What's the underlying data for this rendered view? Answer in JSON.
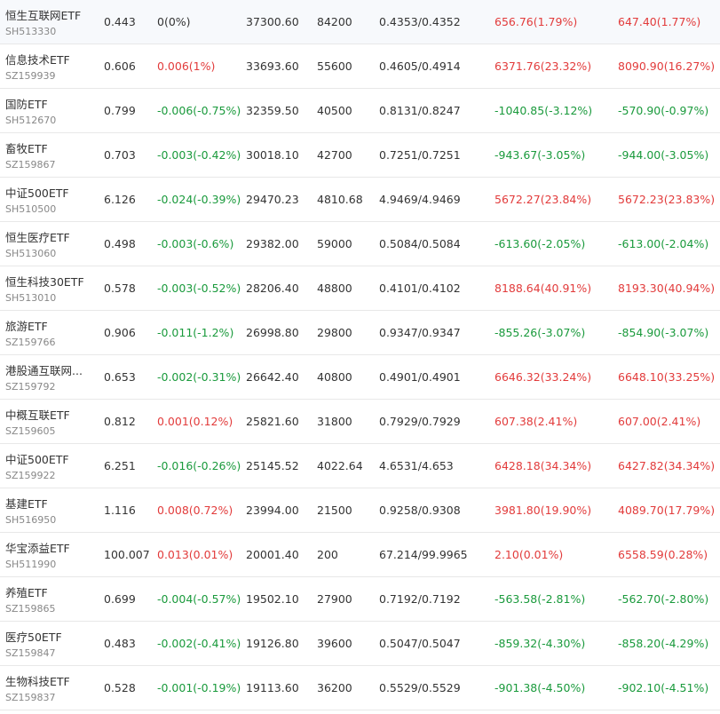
{
  "colors": {
    "up": "#e23b3b",
    "down": "#1a9a3c",
    "flat": "#333333"
  },
  "rows": [
    {
      "name": "恒生互联网ETF",
      "code": "SH513330",
      "price": "0.443",
      "change": "0(0%)",
      "change_dir": "flat",
      "amount": "37300.60",
      "volume": "84200",
      "range": "0.4353/0.4352",
      "val1": "656.76(1.79%)",
      "val1_dir": "up",
      "val2": "647.40(1.77%)",
      "val2_dir": "up"
    },
    {
      "name": "信息技术ETF",
      "code": "SZ159939",
      "price": "0.606",
      "change": "0.006(1%)",
      "change_dir": "up",
      "amount": "33693.60",
      "volume": "55600",
      "range": "0.4605/0.4914",
      "val1": "6371.76(23.32%)",
      "val1_dir": "up",
      "val2": "8090.90(16.27%)",
      "val2_dir": "up"
    },
    {
      "name": "国防ETF",
      "code": "SH512670",
      "price": "0.799",
      "change": "-0.006(-0.75%)",
      "change_dir": "down",
      "amount": "32359.50",
      "volume": "40500",
      "range": "0.8131/0.8247",
      "val1": "-1040.85(-3.12%)",
      "val1_dir": "down",
      "val2": "-570.90(-0.97%)",
      "val2_dir": "down"
    },
    {
      "name": "畜牧ETF",
      "code": "SZ159867",
      "price": "0.703",
      "change": "-0.003(-0.42%)",
      "change_dir": "down",
      "amount": "30018.10",
      "volume": "42700",
      "range": "0.7251/0.7251",
      "val1": "-943.67(-3.05%)",
      "val1_dir": "down",
      "val2": "-944.00(-3.05%)",
      "val2_dir": "down"
    },
    {
      "name": "中证500ETF",
      "code": "SH510500",
      "price": "6.126",
      "change": "-0.024(-0.39%)",
      "change_dir": "down",
      "amount": "29470.23",
      "volume": "4810.68",
      "range": "4.9469/4.9469",
      "val1": "5672.27(23.84%)",
      "val1_dir": "up",
      "val2": "5672.23(23.83%)",
      "val2_dir": "up"
    },
    {
      "name": "恒生医疗ETF",
      "code": "SH513060",
      "price": "0.498",
      "change": "-0.003(-0.6%)",
      "change_dir": "down",
      "amount": "29382.00",
      "volume": "59000",
      "range": "0.5084/0.5084",
      "val1": "-613.60(-2.05%)",
      "val1_dir": "down",
      "val2": "-613.00(-2.04%)",
      "val2_dir": "down"
    },
    {
      "name": "恒生科技30ETF",
      "code": "SH513010",
      "price": "0.578",
      "change": "-0.003(-0.52%)",
      "change_dir": "down",
      "amount": "28206.40",
      "volume": "48800",
      "range": "0.4101/0.4102",
      "val1": "8188.64(40.91%)",
      "val1_dir": "up",
      "val2": "8193.30(40.94%)",
      "val2_dir": "up"
    },
    {
      "name": "旅游ETF",
      "code": "SZ159766",
      "price": "0.906",
      "change": "-0.011(-1.2%)",
      "change_dir": "down",
      "amount": "26998.80",
      "volume": "29800",
      "range": "0.9347/0.9347",
      "val1": "-855.26(-3.07%)",
      "val1_dir": "down",
      "val2": "-854.90(-3.07%)",
      "val2_dir": "down"
    },
    {
      "name": "港股通互联网...",
      "code": "SZ159792",
      "price": "0.653",
      "change": "-0.002(-0.31%)",
      "change_dir": "down",
      "amount": "26642.40",
      "volume": "40800",
      "range": "0.4901/0.4901",
      "val1": "6646.32(33.24%)",
      "val1_dir": "up",
      "val2": "6648.10(33.25%)",
      "val2_dir": "up"
    },
    {
      "name": "中概互联ETF",
      "code": "SZ159605",
      "price": "0.812",
      "change": "0.001(0.12%)",
      "change_dir": "up",
      "amount": "25821.60",
      "volume": "31800",
      "range": "0.7929/0.7929",
      "val1": "607.38(2.41%)",
      "val1_dir": "up",
      "val2": "607.00(2.41%)",
      "val2_dir": "up"
    },
    {
      "name": "中证500ETF",
      "code": "SZ159922",
      "price": "6.251",
      "change": "-0.016(-0.26%)",
      "change_dir": "down",
      "amount": "25145.52",
      "volume": "4022.64",
      "range": "4.6531/4.653",
      "val1": "6428.18(34.34%)",
      "val1_dir": "up",
      "val2": "6427.82(34.34%)",
      "val2_dir": "up"
    },
    {
      "name": "基建ETF",
      "code": "SH516950",
      "price": "1.116",
      "change": "0.008(0.72%)",
      "change_dir": "up",
      "amount": "23994.00",
      "volume": "21500",
      "range": "0.9258/0.9308",
      "val1": "3981.80(19.90%)",
      "val1_dir": "up",
      "val2": "4089.70(17.79%)",
      "val2_dir": "up"
    },
    {
      "name": "华宝添益ETF",
      "code": "SH511990",
      "price": "100.007",
      "change": "0.013(0.01%)",
      "change_dir": "up",
      "amount": "20001.40",
      "volume": "200",
      "range": "67.214/99.9965",
      "val1": "2.10(0.01%)",
      "val1_dir": "up",
      "val2": "6558.59(0.28%)",
      "val2_dir": "up"
    },
    {
      "name": "养殖ETF",
      "code": "SZ159865",
      "price": "0.699",
      "change": "-0.004(-0.57%)",
      "change_dir": "down",
      "amount": "19502.10",
      "volume": "27900",
      "range": "0.7192/0.7192",
      "val1": "-563.58(-2.81%)",
      "val1_dir": "down",
      "val2": "-562.70(-2.80%)",
      "val2_dir": "down"
    },
    {
      "name": "医疗50ETF",
      "code": "SZ159847",
      "price": "0.483",
      "change": "-0.002(-0.41%)",
      "change_dir": "down",
      "amount": "19126.80",
      "volume": "39600",
      "range": "0.5047/0.5047",
      "val1": "-859.32(-4.30%)",
      "val1_dir": "down",
      "val2": "-858.20(-4.29%)",
      "val2_dir": "down"
    },
    {
      "name": "生物科技ETF",
      "code": "SZ159837",
      "price": "0.528",
      "change": "-0.001(-0.19%)",
      "change_dir": "down",
      "amount": "19113.60",
      "volume": "36200",
      "range": "0.5529/0.5529",
      "val1": "-901.38(-4.50%)",
      "val1_dir": "down",
      "val2": "-902.10(-4.51%)",
      "val2_dir": "down"
    }
  ]
}
